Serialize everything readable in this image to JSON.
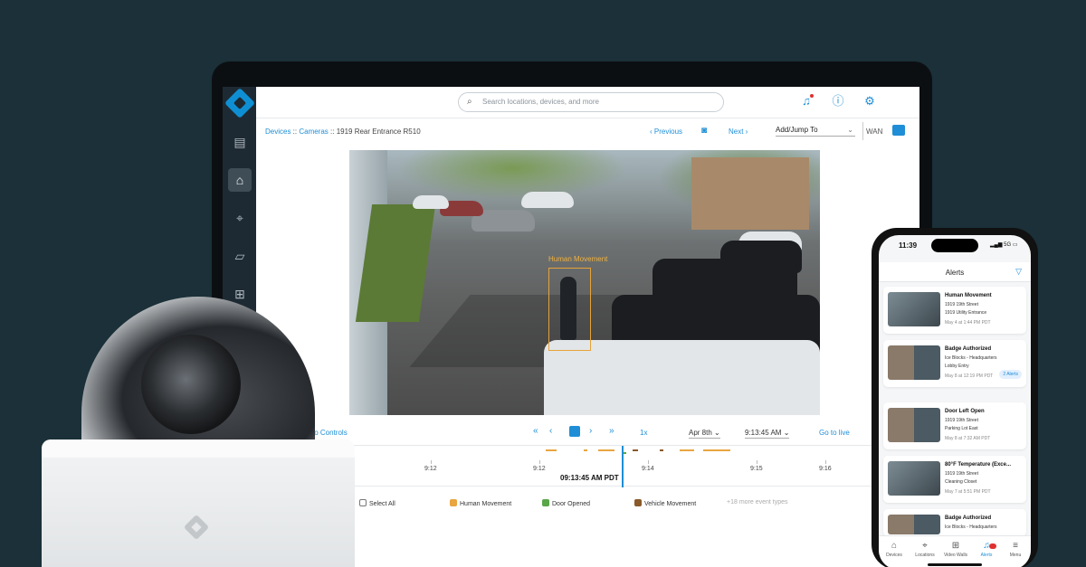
{
  "app": {
    "search_placeholder": "Search locations, devices, and more"
  },
  "breadcrumb": {
    "devices": "Devices",
    "sep1": " :: ",
    "cameras": "Cameras",
    "sep2": " :: ",
    "current": "1919 Rear Entrance R510"
  },
  "nav": {
    "previous": "‹ Previous",
    "next": "Next ›",
    "jump_to": "Add/Jump To",
    "wan": "WAN"
  },
  "video": {
    "detection_label": "Human Movement"
  },
  "controls": {
    "audio": "dio Controls",
    "speed": "1x",
    "date": "Apr 8th ⌄",
    "time": "9:13:45 AM ⌄",
    "go_live": "Go to live"
  },
  "timeline": {
    "ticks": [
      "9:12",
      "9:12",
      "9:14",
      "9:15",
      "9:16"
    ],
    "playhead_time": "09:13:45 AM PDT"
  },
  "filters": {
    "select_all": "Select All",
    "human": "Human Movement",
    "door": "Door Opened",
    "vehicle": "Vehicle Movement",
    "more": "+18 more event types"
  },
  "phone": {
    "clock": "11:39",
    "status": "▂▄▆ 5G ▭",
    "header": "Alerts",
    "alerts": [
      {
        "title": "Human Movement",
        "line1": "1919 19th Street",
        "line2": "1919 Utility Entrance",
        "date": "May 4 at 1:44 PM PDT",
        "pill": ""
      },
      {
        "title": "Badge Authorized",
        "line1": "Ice Blocks - Headquarters",
        "line2": "Lobby Entry",
        "date": "May 8 at 12:19 PM PDT",
        "pill": "2 Alerts"
      },
      {
        "title": "Door Left Open",
        "line1": "1919 19th Street",
        "line2": "Parking Lot East",
        "date": "May 8 at 7:32 AM PDT",
        "pill": ""
      },
      {
        "title": "80°F Temperature (Exce...",
        "line1": "1919 19th Street",
        "line2": "Cleaning Closet",
        "date": "May 7 at 5:51 PM PDT",
        "pill": ""
      },
      {
        "title": "Badge Authorized",
        "line1": "Ice Blocks - Headquarters",
        "line2": "",
        "date": "",
        "pill": ""
      }
    ],
    "tabs": [
      "Devices",
      "Locations",
      "Video Walls",
      "Alerts",
      "Menu"
    ]
  },
  "colors": {
    "accent": "#1f8ed6",
    "background": "#1b3038",
    "human": "#e9a540",
    "door": "#5aa649",
    "vehicle": "#8a5a2a"
  },
  "icons": [
    "logo-icon",
    "sidebar-grid-icon",
    "camera-icon",
    "location-pin-icon",
    "map-icon",
    "video-wall-icon",
    "search-icon",
    "bell-icon",
    "help-icon",
    "gear-icon",
    "snapshot-icon",
    "monitor-icon",
    "filter-icon"
  ]
}
